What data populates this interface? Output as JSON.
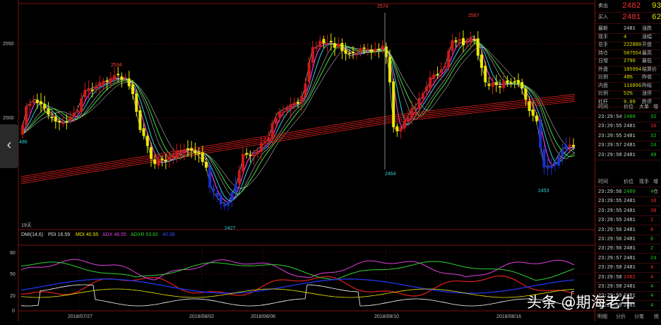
{
  "indicator": {
    "name": "DMI(14,6)",
    "pdi": "PDI 16.59",
    "mdi": "MDI 40.55",
    "adx": "ADX 46.55",
    "adxr": "ADXR 53.82",
    "extra": "40.38"
  },
  "price_axis": [
    "2550",
    "2500"
  ],
  "osc_axis": [
    "80",
    "50",
    "20",
    "0"
  ],
  "price_labels": {
    "high1": "2534",
    "high2": "2574",
    "high3": "2567",
    "low1": "2427",
    "low2": "2464",
    "low3": "2453",
    "left": "486"
  },
  "period_label": "19天",
  "dates": [
    "2018/07/27",
    "2018/08/02",
    "2018/08/06",
    "2018/08/10",
    "2018/08/16"
  ],
  "quote": {
    "ask_label": "卖出",
    "ask_price": "2482",
    "ask_vol": "93",
    "bid_label": "买入",
    "bid_price": "2481",
    "bid_vol": "62",
    "fields": [
      {
        "l1": "最新",
        "v1": "2481",
        "l2": "涨跌",
        "c": "white"
      },
      {
        "l1": "现手",
        "v1": "4",
        "l2": "涨幅",
        "c": "yellow"
      },
      {
        "l1": "总手",
        "v1": "222880",
        "l2": "开盘",
        "c": "yellow"
      },
      {
        "l1": "持仓",
        "v1": "507554",
        "l2": "最高",
        "c": "yellow"
      },
      {
        "l1": "日增",
        "v1": "2790",
        "l2": "最低",
        "c": "yellow"
      },
      {
        "l1": "外盘",
        "v1": "105994",
        "l2": "结算价",
        "c": "yellow"
      },
      {
        "l1": "比例",
        "v1": "48%",
        "l2": "昨收",
        "c": "yellow"
      },
      {
        "l1": "内盘",
        "v1": "116896",
        "l2": "昨结",
        "c": "yellow"
      },
      {
        "l1": "比例",
        "v1": "52%",
        "l2": "涨停",
        "c": "yellow"
      },
      {
        "l1": "杠杆",
        "v1": "9.09",
        "l2": "跌停",
        "c": "yellow"
      }
    ]
  },
  "ticks1": {
    "headers": [
      "时间",
      "价位",
      "大单",
      "增"
    ],
    "rows": [
      {
        "t": "23:29:54",
        "p": "2480",
        "v": "32",
        "pc": "green",
        "vc": "green"
      },
      {
        "t": "23:29:55",
        "p": "2481",
        "v": "16",
        "pc": "white",
        "vc": "red"
      },
      {
        "t": "23:29:55",
        "p": "2481",
        "v": "32",
        "pc": "white",
        "vc": "green"
      },
      {
        "t": "23:29:57",
        "p": "2481",
        "v": "24",
        "pc": "white",
        "vc": "green"
      },
      {
        "t": "23:29:58",
        "p": "2481",
        "v": "40",
        "pc": "white",
        "vc": "green"
      }
    ]
  },
  "ticks2": {
    "headers": [
      "时间",
      "价位",
      "现手",
      "增仓"
    ],
    "rows": [
      {
        "t": "23:29:56",
        "p": "2480",
        "v": "4",
        "pc": "green",
        "vc": "green"
      },
      {
        "t": "23:29:55",
        "p": "2481",
        "v": "18",
        "pc": "white",
        "vc": "red"
      },
      {
        "t": "23:29:55",
        "p": "2481",
        "v": "30",
        "pc": "white",
        "vc": "red"
      },
      {
        "t": "23:29:55",
        "p": "2481",
        "v": "2",
        "pc": "white",
        "vc": "red"
      },
      {
        "t": "23:29:56",
        "p": "2481",
        "v": "6",
        "pc": "white",
        "vc": "red"
      },
      {
        "t": "23:29:56",
        "p": "2481",
        "v": "6",
        "pc": "white",
        "vc": "green"
      },
      {
        "t": "23:29:56",
        "p": "2481",
        "v": "2",
        "pc": "white",
        "vc": "green"
      },
      {
        "t": "23:29:57",
        "p": "2481",
        "v": "24",
        "pc": "white",
        "vc": "green"
      },
      {
        "t": "23:29:58",
        "p": "2481",
        "v": "4",
        "pc": "white",
        "vc": "red"
      },
      {
        "t": "23:29:58",
        "p": "2482",
        "v": "4",
        "pc": "red",
        "vc": "red"
      },
      {
        "t": "23:29:58",
        "p": "2481",
        "v": "4",
        "pc": "white",
        "vc": "green"
      },
      {
        "t": "23:29:59",
        "p": "2481",
        "v": "4",
        "pc": "white",
        "vc": "green"
      },
      {
        "t": "23:29:59",
        "p": "2481",
        "v": "4",
        "pc": "white",
        "vc": "green"
      }
    ]
  },
  "bottom_tabs": [
    "明细",
    "分价",
    "分笔",
    "统"
  ],
  "watermark": "头条 @期海老牛",
  "colors": {
    "up": "#d01818",
    "down": "#e8e800",
    "blue": "#1830d0",
    "grid": "#7a1010"
  }
}
